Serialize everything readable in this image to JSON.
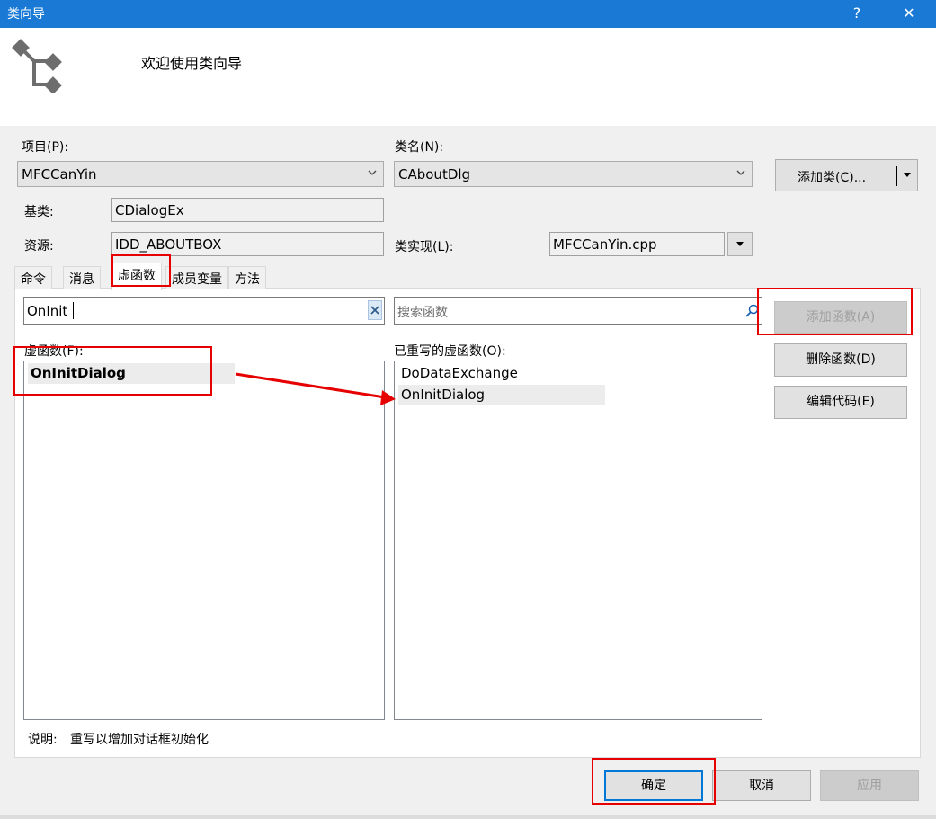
{
  "window": {
    "title": "类向导",
    "help_label": "?",
    "close_label": "✕"
  },
  "header": {
    "welcome": "欢迎使用类向导",
    "logo_icon": "class-wizard-icon"
  },
  "project": {
    "label": "项目(P):",
    "value": "MFCCanYin"
  },
  "class_name": {
    "label": "类名(N):",
    "value": "CAboutDlg"
  },
  "add_class_button": {
    "label": "添加类(C)..."
  },
  "base_class": {
    "label": "基类:",
    "value": "CDialogEx"
  },
  "resource": {
    "label": "资源:",
    "value": "IDD_ABOUTBOX"
  },
  "class_impl": {
    "label": "类实现(L):",
    "value": "MFCCanYin.cpp"
  },
  "tabs": [
    {
      "label": "命令"
    },
    {
      "label": "消息"
    },
    {
      "label": "虚函数",
      "active": true
    },
    {
      "label": "成员变量"
    },
    {
      "label": "方法"
    }
  ],
  "virtual_search": {
    "value": "OnInit"
  },
  "overridden_search": {
    "placeholder": "搜索函数"
  },
  "virtual_functions": {
    "label": "虚函数(F):",
    "items": [
      {
        "name": "OnInitDialog",
        "selected": true
      }
    ]
  },
  "overridden_functions": {
    "label": "已重写的虚函数(O):",
    "items": [
      {
        "name": "DoDataExchange"
      },
      {
        "name": "OnInitDialog"
      }
    ]
  },
  "buttons": {
    "add_function": "添加函数(A)",
    "delete_function": "删除函数(D)",
    "edit_code": "编辑代码(E)",
    "ok": "确定",
    "cancel": "取消",
    "apply": "应用"
  },
  "description": {
    "label": "说明:",
    "text": "重写以增加对话框初始化"
  },
  "colors": {
    "titlebar": "#1979d4",
    "annotation": "#e60000",
    "default_button_border": "#0078d7"
  }
}
